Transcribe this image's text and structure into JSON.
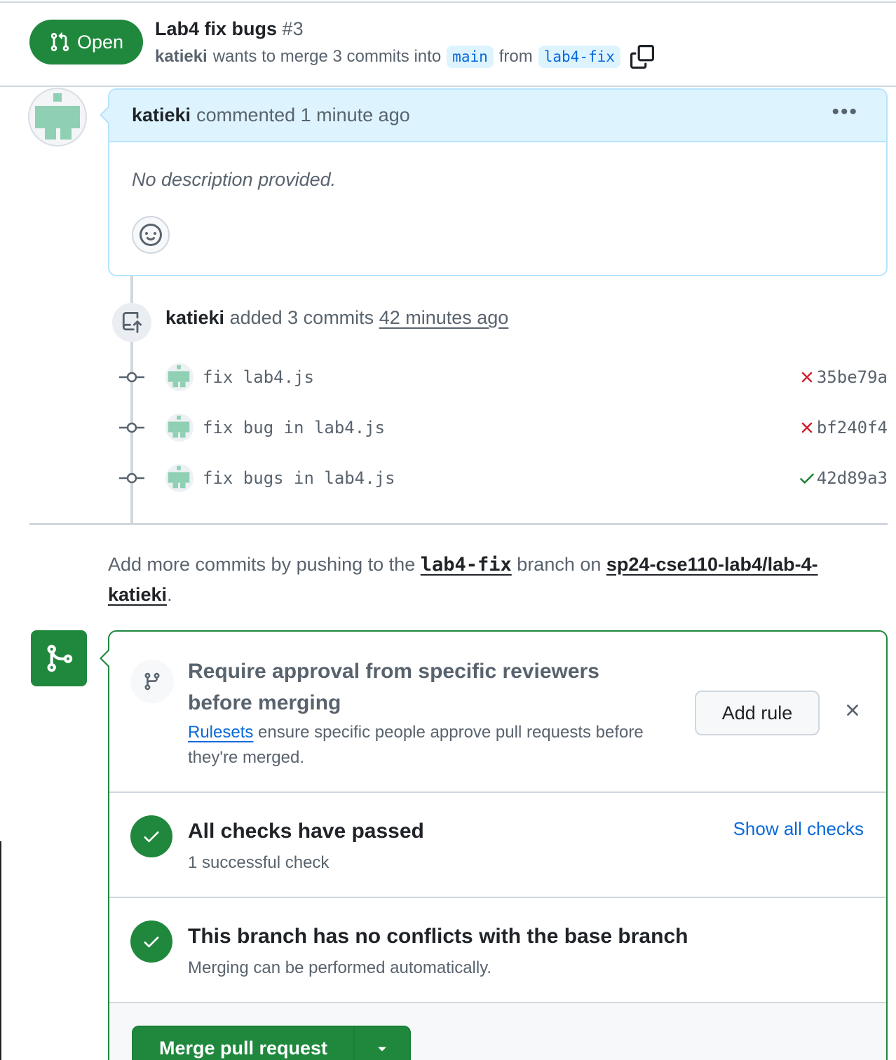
{
  "header": {
    "state": "Open",
    "title": "Lab4 fix bugs",
    "number": "#3",
    "author": "katieki",
    "merge_text": "wants to merge 3 commits into",
    "base_branch": "main",
    "from_text": "from",
    "head_branch": "lab4-fix"
  },
  "comment": {
    "author": "katieki",
    "action": "commented 1 minute ago",
    "body": "No description provided."
  },
  "push_event": {
    "author": "katieki",
    "text": "added 3 commits",
    "ago": "42 minutes ago"
  },
  "commits": [
    {
      "message": "fix lab4.js",
      "sha": "35be79a",
      "status": "failure"
    },
    {
      "message": "fix bug in lab4.js",
      "sha": "bf240f4",
      "status": "failure"
    },
    {
      "message": "fix bugs in lab4.js",
      "sha": "42d89a3",
      "status": "success"
    }
  ],
  "hint": {
    "prefix": "Add more commits by pushing to the",
    "branch": "lab4-fix",
    "middle": "branch on",
    "repo": "sp24-cse110-lab4/lab-4-katieki",
    "suffix": "."
  },
  "merge_box": {
    "ruleset": {
      "title": "Require approval from specific reviewers before merging",
      "link": "Rulesets",
      "desc": "ensure specific people approve pull requests before they're merged.",
      "button": "Add rule"
    },
    "checks": {
      "title": "All checks have passed",
      "desc": "1 successful check",
      "link": "Show all checks"
    },
    "conflicts": {
      "title": "This branch has no conflicts with the base branch",
      "desc": "Merging can be performed automatically."
    },
    "merge_button": "Merge pull request"
  },
  "colors": {
    "success_green": "#1f883d",
    "link_blue": "#0969da",
    "failure_red": "#cf222e",
    "comment_header_bg": "#ddf4ff"
  }
}
